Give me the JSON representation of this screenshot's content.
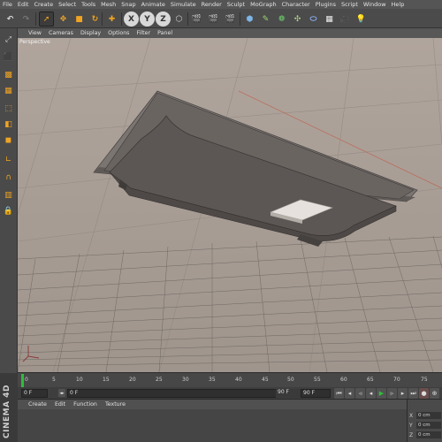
{
  "menubar": {
    "items": [
      "File",
      "Edit",
      "Create",
      "Select",
      "Tools",
      "Mesh",
      "Snap",
      "Animate",
      "Simulate",
      "Render",
      "Sculpt",
      "MoGraph",
      "Character",
      "Plugins",
      "Script",
      "Window",
      "Help"
    ]
  },
  "toolbar": {
    "axis_x": "X",
    "axis_y": "Y",
    "axis_z": "Z"
  },
  "viewport": {
    "menu": [
      "View",
      "Cameras",
      "Display",
      "Options",
      "Filter",
      "Panel"
    ],
    "label": "Perspective"
  },
  "timeline": {
    "ticks": [
      "0",
      "5",
      "10",
      "15",
      "20",
      "25",
      "30",
      "35",
      "40",
      "45",
      "50",
      "55",
      "60",
      "65",
      "70",
      "75"
    ]
  },
  "transport": {
    "current_frame": "0 F",
    "start_field": "0 F",
    "end_field_a": "90 F",
    "end_field_b": "90 F"
  },
  "material_manager": {
    "menu": [
      "Create",
      "Edit",
      "Function",
      "Texture"
    ]
  },
  "coordinates": {
    "rows": [
      {
        "axis": "X",
        "value": "0 cm"
      },
      {
        "axis": "Y",
        "value": "0 cm"
      },
      {
        "axis": "Z",
        "value": "0 cm"
      }
    ]
  },
  "brand_text": "CINEMA 4D",
  "colors": {
    "accent_orange": "#f0a422",
    "timeline_green": "#2fbd3a",
    "model_gray": "#6e6966",
    "background": "#a89e97"
  }
}
